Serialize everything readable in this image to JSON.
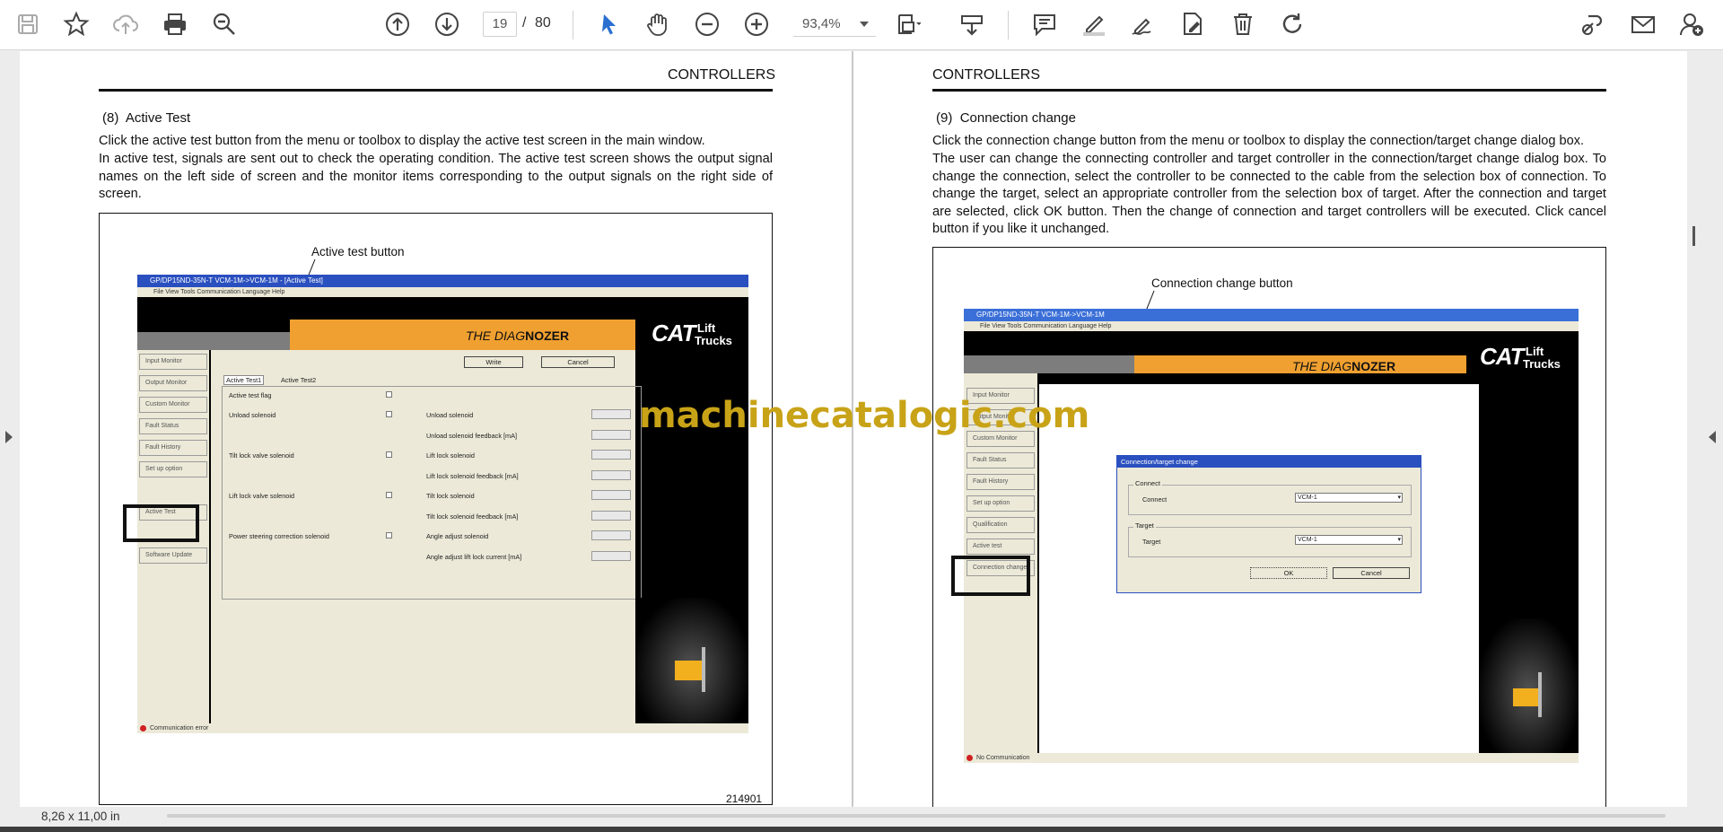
{
  "toolbar": {
    "current_page": "19",
    "separator": "/",
    "page_count": "80",
    "zoom": "93,4%"
  },
  "status": {
    "page_size": "8,26 x 11,00 in"
  },
  "watermark": "machinecatalogic.com",
  "page1": {
    "header": "CONTROLLERS",
    "section_num": "(8)",
    "section_title": "Active Test",
    "para1": "Click the active test button from the menu or toolbox to display the active test screen in the main window.",
    "para2": "In active test, signals are sent out to check the operating condition. The active test screen shows the output signal names on the left side of screen and the monitor items corresponding to the output signals on the right side of screen.",
    "callout": "Active test button",
    "fig_number": "214901",
    "screenshot": {
      "title": "GP/DP15ND-35N-T VCM-1M->VCM-1M - [Active Test]",
      "menu": "File   View   Tools   Communication   Language   Help",
      "brand_prefix": "THE DIAG",
      "brand_suffix": "NOZER",
      "cat": "CAT",
      "lift": "Lift",
      "trucks": "Trucks",
      "nav": [
        "Input Monitor",
        "Output Monitor",
        "Custom Monitor",
        "Fault Status",
        "Fault History",
        "Set up option",
        "",
        "Active Test",
        "Software Update"
      ],
      "write_btn": "Write",
      "cancel_btn": "Cancel",
      "tab1": "Active Test1",
      "tab2": "Active Test2",
      "left_items": [
        "Active test flag",
        "Unload solenoid",
        "Tilt lock valve solenoid",
        "Lift lock valve solenoid",
        "Power steering correction solenoid"
      ],
      "right_items": [
        "Unload solenoid",
        "Unload solenoid feedback [mA]",
        "Lift lock solenoid",
        "Lift lock solenoid feedback [mA]",
        "Tilt lock solenoid",
        "Tilt lock solenoid feedback [mA]",
        "Angle adjust solenoid",
        "Angle adjust lift lock current [mA]"
      ],
      "status": "Communication error"
    }
  },
  "page2": {
    "header": "CONTROLLERS",
    "section_num": "(9)",
    "section_title": "Connection change",
    "para1": "Click the connection change button from the menu or toolbox to display the connection/target change dialog box.",
    "para2": "The user can change the connecting controller and target controller in the connection/target change dialog box. To change the connection, select the controller to be connected to the cable from the selection box of connection. To change the target, select an appropriate controller from the selection box of target. After the connection and target are selected, click OK button. Then the change of connection and target controllers will be executed. Click cancel button if you like it unchanged.",
    "callout": "Connection change button",
    "screenshot": {
      "title": "GP/DP15ND-35N-T VCM-1M->VCM-1M",
      "menu": "File   View   Tools   Communication   Language   Help",
      "brand_prefix": "THE DIAG",
      "brand_suffix": "NOZER",
      "cat": "CAT",
      "lift": "Lift",
      "trucks": "Trucks",
      "nav": [
        "Input Monitor",
        "Output Monitor",
        "Custom Monitor",
        "Fault Status",
        "Fault History",
        "Set up option",
        "Qualification",
        "Active test",
        "Connection change"
      ],
      "dialog_title": "Connection/target change",
      "connect_group": "Connect",
      "connect_label": "Connect",
      "connect_value": "VCM-1",
      "target_group": "Target",
      "target_label": "Target",
      "target_value": "VCM-1",
      "ok": "OK",
      "cancel": "Cancel",
      "status": "No Communication"
    }
  }
}
